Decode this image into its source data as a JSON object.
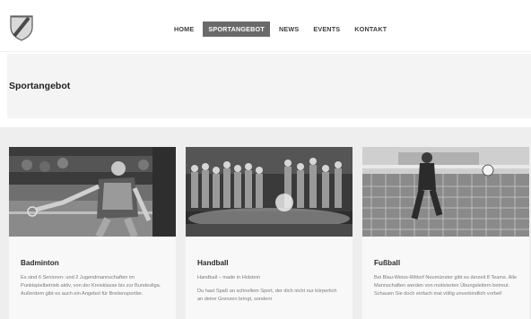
{
  "nav": {
    "items": [
      {
        "label": "HOME"
      },
      {
        "label": "SPORTANGEBOT"
      },
      {
        "label": "NEWS"
      },
      {
        "label": "EVENTS"
      },
      {
        "label": "KONTAKT"
      }
    ]
  },
  "hero": {
    "title": "Sportangebot"
  },
  "cards": [
    {
      "title": "Badminton",
      "text": "Es sind 6 Senioren- und 2 Jugendmannschaften im Punktspielbetrieb aktiv, von der Kreisklasse bis zur Bundesliga. Außerdem gibt es auch ein Angebot für Breitensportler."
    },
    {
      "title": "Handball",
      "subtitle": "Handball – made in Holstein",
      "text": "Du hast Spaß an schnellem Sport, der dich nicht nur körperlich an deine Grenzen bringt, sondern"
    },
    {
      "title": "Fußball",
      "text": "Bei Blau-Weiss-Wittorf Neumünster gibt es derzeit 8 Teams. Alle Mannschaften werden von motivierten Übungsleitern betreut. Schauen Sie doch einfach mal völlig unverbindlich vorbei!"
    }
  ]
}
